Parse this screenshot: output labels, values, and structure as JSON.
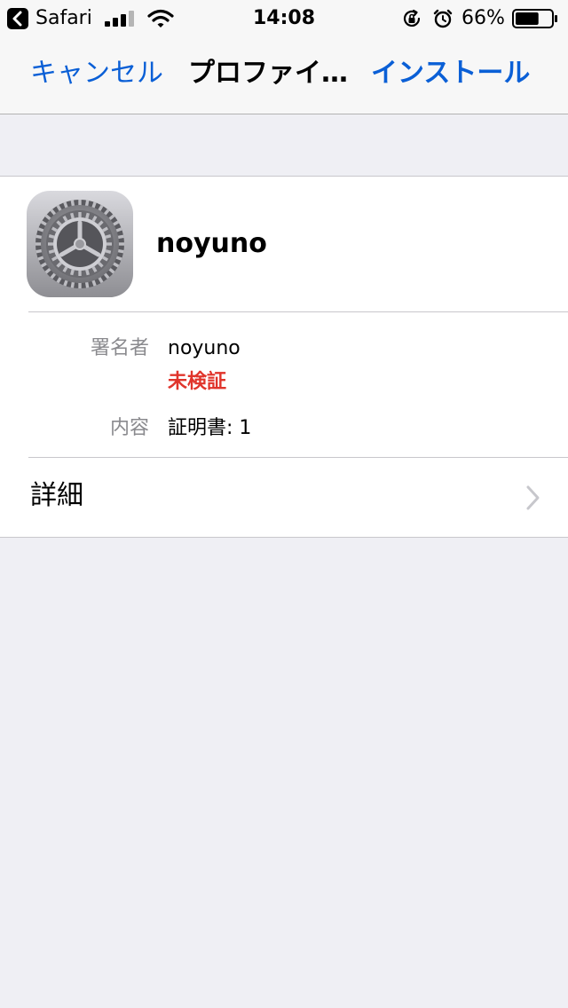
{
  "status_bar": {
    "back_app": "Safari",
    "time": "14:08",
    "battery_percent": "66%",
    "battery_level": 0.66,
    "icons": [
      "back-arrow-icon",
      "signal-icon",
      "wifi-icon",
      "rotation-lock-icon",
      "alarm-icon",
      "battery-icon"
    ]
  },
  "nav": {
    "cancel_label": "キャンセル",
    "title": "プロファイ…",
    "install_label": "インストール"
  },
  "profile": {
    "icon": "settings-gear-icon",
    "name": "noyuno",
    "signer_label": "署名者",
    "signer_value": "noyuno",
    "verification_status": "未検証",
    "contents_label": "内容",
    "contents_value": "証明書: 1",
    "details_label": "詳細"
  },
  "colors": {
    "accent": "#0a5fd6",
    "warning": "#e0342b",
    "background": "#efeff4"
  }
}
